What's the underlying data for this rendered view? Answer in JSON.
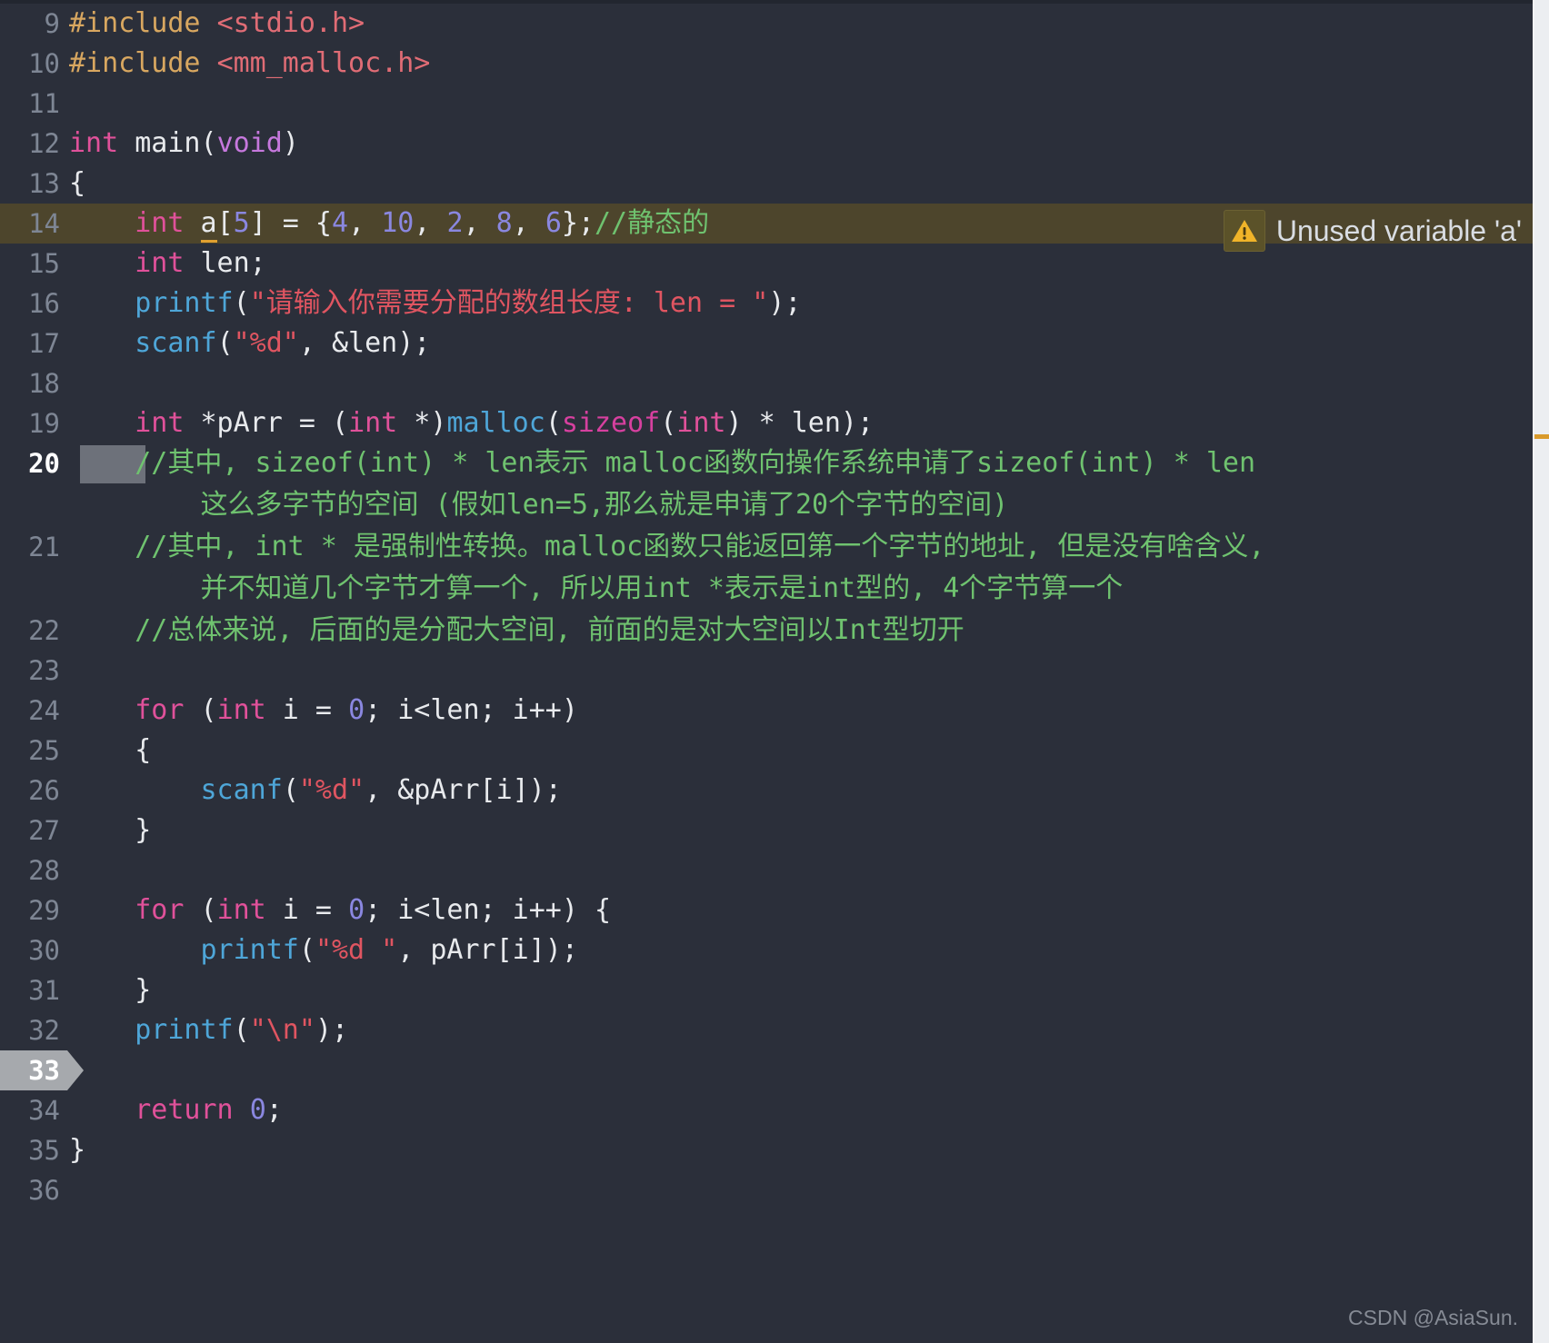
{
  "editor": {
    "theme_background": "#2b2f3a",
    "gutter_color": "#7e8694",
    "warning_row_background": "#4d452c",
    "selection_color": "#6d717a",
    "current_line_marker_color": "#a6a9ad"
  },
  "warning_badge": {
    "icon": "warning-triangle-icon",
    "text": "Unused variable 'a'",
    "icon_color": "#f0b429",
    "line": 14
  },
  "watermark": {
    "text": "CSDN @AsiaSun."
  },
  "ruler": {
    "tick_color": "#d99a2b"
  },
  "lines": [
    {
      "n": "9",
      "segments": [
        {
          "t": "#include ",
          "c": "pp"
        },
        {
          "t": "<stdio.h>",
          "c": "hdr"
        }
      ]
    },
    {
      "n": "10",
      "segments": [
        {
          "t": "#include ",
          "c": "pp"
        },
        {
          "t": "<mm_malloc.h>",
          "c": "hdr"
        }
      ]
    },
    {
      "n": "11",
      "segments": []
    },
    {
      "n": "12",
      "segments": [
        {
          "t": "int",
          "c": "kw"
        },
        {
          "t": " main",
          "c": "plain"
        },
        {
          "t": "(",
          "c": "plain"
        },
        {
          "t": "void",
          "c": "kw2"
        },
        {
          "t": ")",
          "c": "plain"
        }
      ]
    },
    {
      "n": "13",
      "segments": [
        {
          "t": "{",
          "c": "plain"
        }
      ]
    },
    {
      "n": "14",
      "warning": true,
      "segments": [
        {
          "t": "    ",
          "c": "plain"
        },
        {
          "t": "int",
          "c": "kw"
        },
        {
          "t": " ",
          "c": "plain"
        },
        {
          "t": "a",
          "c": "ident-warn"
        },
        {
          "t": "[",
          "c": "plain"
        },
        {
          "t": "5",
          "c": "num"
        },
        {
          "t": "] = {",
          "c": "plain"
        },
        {
          "t": "4",
          "c": "num"
        },
        {
          "t": ", ",
          "c": "plain"
        },
        {
          "t": "10",
          "c": "num"
        },
        {
          "t": ", ",
          "c": "plain"
        },
        {
          "t": "2",
          "c": "num"
        },
        {
          "t": ", ",
          "c": "plain"
        },
        {
          "t": "8",
          "c": "num"
        },
        {
          "t": ", ",
          "c": "plain"
        },
        {
          "t": "6",
          "c": "num"
        },
        {
          "t": "};",
          "c": "plain"
        },
        {
          "t": "//静态的",
          "c": "cmt"
        }
      ]
    },
    {
      "n": "15",
      "segments": [
        {
          "t": "    ",
          "c": "plain"
        },
        {
          "t": "int",
          "c": "kw"
        },
        {
          "t": " len;",
          "c": "plain"
        }
      ]
    },
    {
      "n": "16",
      "segments": [
        {
          "t": "    ",
          "c": "plain"
        },
        {
          "t": "printf",
          "c": "fn"
        },
        {
          "t": "(",
          "c": "plain"
        },
        {
          "t": "\"请输入你需要分配的数组长度: len = \"",
          "c": "str"
        },
        {
          "t": ");",
          "c": "plain"
        }
      ]
    },
    {
      "n": "17",
      "segments": [
        {
          "t": "    ",
          "c": "plain"
        },
        {
          "t": "scanf",
          "c": "fn"
        },
        {
          "t": "(",
          "c": "plain"
        },
        {
          "t": "\"%d\"",
          "c": "str"
        },
        {
          "t": ", &len);",
          "c": "plain"
        }
      ]
    },
    {
      "n": "18",
      "segments": []
    },
    {
      "n": "19",
      "segments": [
        {
          "t": "    ",
          "c": "plain"
        },
        {
          "t": "int",
          "c": "kw"
        },
        {
          "t": " *pArr = (",
          "c": "plain"
        },
        {
          "t": "int",
          "c": "kw"
        },
        {
          "t": " *)",
          "c": "plain"
        },
        {
          "t": "malloc",
          "c": "fn"
        },
        {
          "t": "(",
          "c": "plain"
        },
        {
          "t": "sizeof",
          "c": "mag"
        },
        {
          "t": "(",
          "c": "plain"
        },
        {
          "t": "int",
          "c": "kw"
        },
        {
          "t": ") * len);",
          "c": "plain"
        }
      ]
    },
    {
      "n": "20",
      "selected_indent": true,
      "segments": [
        {
          "t": "    ",
          "c": "plain"
        },
        {
          "t": "//其中, sizeof(int) * len表示 malloc函数向操作系统申请了sizeof(int) * len",
          "c": "cmt"
        }
      ],
      "wrap": [
        {
          "t": "        这么多字节的空间 (假如len=5,那么就是申请了20个字节的空间)",
          "c": "cmt"
        }
      ]
    },
    {
      "n": "21",
      "segments": [
        {
          "t": "    ",
          "c": "plain"
        },
        {
          "t": "//其中, int * 是强制性转换。malloc函数只能返回第一个字节的地址, 但是没有啥含义,",
          "c": "cmt"
        }
      ],
      "wrap": [
        {
          "t": "        并不知道几个字节才算一个, 所以用int *表示是int型的, 4个字节算一个",
          "c": "cmt"
        }
      ]
    },
    {
      "n": "22",
      "segments": [
        {
          "t": "    ",
          "c": "plain"
        },
        {
          "t": "//总体来说, 后面的是分配大空间, 前面的是对大空间以Int型切开",
          "c": "cmt"
        }
      ]
    },
    {
      "n": "23",
      "segments": []
    },
    {
      "n": "24",
      "segments": [
        {
          "t": "    ",
          "c": "plain"
        },
        {
          "t": "for",
          "c": "kw"
        },
        {
          "t": " (",
          "c": "plain"
        },
        {
          "t": "int",
          "c": "kw"
        },
        {
          "t": " i = ",
          "c": "plain"
        },
        {
          "t": "0",
          "c": "num"
        },
        {
          "t": "; i<len; i++)",
          "c": "plain"
        }
      ]
    },
    {
      "n": "25",
      "segments": [
        {
          "t": "    {",
          "c": "plain"
        }
      ]
    },
    {
      "n": "26",
      "segments": [
        {
          "t": "        ",
          "c": "plain"
        },
        {
          "t": "scanf",
          "c": "fn"
        },
        {
          "t": "(",
          "c": "plain"
        },
        {
          "t": "\"%d\"",
          "c": "str"
        },
        {
          "t": ", &pArr[i]);",
          "c": "plain"
        }
      ]
    },
    {
      "n": "27",
      "segments": [
        {
          "t": "    }",
          "c": "plain"
        }
      ]
    },
    {
      "n": "28",
      "segments": []
    },
    {
      "n": "29",
      "segments": [
        {
          "t": "    ",
          "c": "plain"
        },
        {
          "t": "for",
          "c": "kw"
        },
        {
          "t": " (",
          "c": "plain"
        },
        {
          "t": "int",
          "c": "kw"
        },
        {
          "t": " i = ",
          "c": "plain"
        },
        {
          "t": "0",
          "c": "num"
        },
        {
          "t": "; i<len; i++) {",
          "c": "plain"
        }
      ]
    },
    {
      "n": "30",
      "segments": [
        {
          "t": "        ",
          "c": "plain"
        },
        {
          "t": "printf",
          "c": "fn"
        },
        {
          "t": "(",
          "c": "plain"
        },
        {
          "t": "\"%d \"",
          "c": "str"
        },
        {
          "t": ", pArr[i]);",
          "c": "plain"
        }
      ]
    },
    {
      "n": "31",
      "segments": [
        {
          "t": "    }",
          "c": "plain"
        }
      ]
    },
    {
      "n": "32",
      "segments": [
        {
          "t": "    ",
          "c": "plain"
        },
        {
          "t": "printf",
          "c": "fn"
        },
        {
          "t": "(",
          "c": "plain"
        },
        {
          "t": "\"\\n\"",
          "c": "str"
        },
        {
          "t": ");",
          "c": "plain"
        }
      ]
    },
    {
      "n": "33",
      "current": true,
      "segments": []
    },
    {
      "n": "34",
      "segments": [
        {
          "t": "    ",
          "c": "plain"
        },
        {
          "t": "return",
          "c": "kw"
        },
        {
          "t": " ",
          "c": "plain"
        },
        {
          "t": "0",
          "c": "num"
        },
        {
          "t": ";",
          "c": "plain"
        }
      ]
    },
    {
      "n": "35",
      "segments": [
        {
          "t": "}",
          "c": "plain"
        }
      ]
    },
    {
      "n": "36",
      "segments": []
    }
  ]
}
